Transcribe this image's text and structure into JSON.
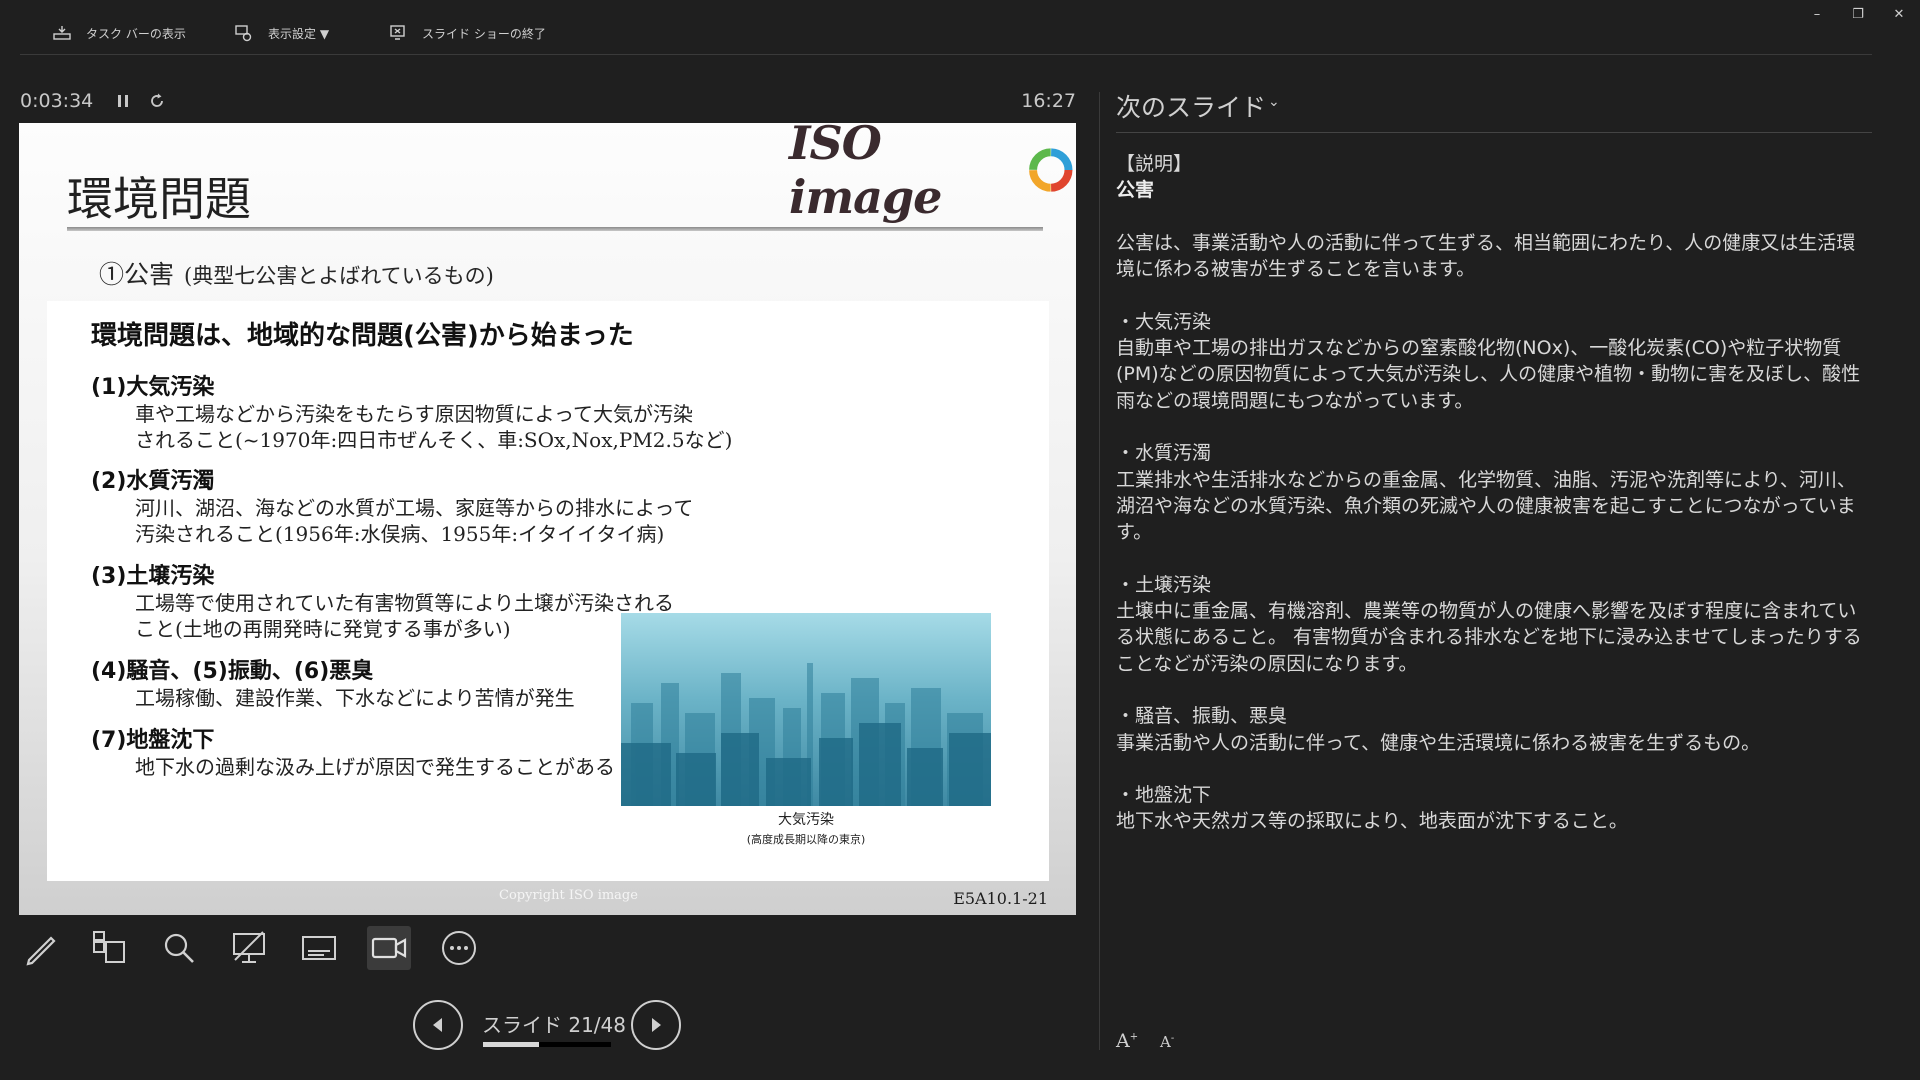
{
  "topbar": {
    "taskbar_label": "タスク バーの表示",
    "display_settings_label": "表示設定 ▼",
    "end_show_label": "スライド ショーの終了"
  },
  "window_controls": {
    "minimize": "–",
    "restore": "❐",
    "close": "✕"
  },
  "presenter": {
    "elapsed": "0:03:34",
    "clock": "16:27",
    "slide_counter": "スライド 21/48",
    "progress": 0.4375
  },
  "slide": {
    "title": "環境問題",
    "logo_text": "ISO image",
    "subheading": "①公害",
    "subheading_note": "(典型七公害とよばれているもの)",
    "content_heading": "環境問題は、地域的な問題(公害)から始まった",
    "items": [
      {
        "head": "(1)大気汚染",
        "body": "車や工場などから汚染をもたらす原因物質によって大気が汚染\nされること(~1970年:四日市ぜんそく、車:SOx,Nox,PM2.5など)"
      },
      {
        "head": "(2)水質汚濁",
        "body": "河川、湖沼、海などの水質が工場、家庭等からの排水によって\n汚染されること(1956年:水俣病、1955年:イタイイタイ病)"
      },
      {
        "head": "(3)土壌汚染",
        "body": "工場等で使用されていた有害物質等により土壌が汚染される\nこと(土地の再開発時に発覚する事が多い)"
      },
      {
        "head": "(4)騒音、(5)振動、(6)悪臭",
        "body": "工場稼働、建設作業、下水などにより苦情が発生"
      },
      {
        "head": "(7)地盤沈下",
        "body": "地下水の過剰な汲み上げが原因で発生することがある"
      }
    ],
    "photo_caption": "大気汚染",
    "photo_caption_sub": "(高度成長期以降の東京)",
    "copyright": "Copyright ISO image",
    "slide_code": "E5A10.1-21"
  },
  "notes": {
    "panel_title": "次のスライド",
    "lines": [
      "【説明】",
      "公害",
      "",
      "公害は、事業活動や人の活動に伴って生ずる、相当範囲にわたり、人の健康又は生活環境に係わる被害が生ずることを言います。",
      "",
      "・大気汚染",
      "自動車や工場の排出ガスなどからの窒素酸化物(NOx)、一酸化炭素(CO)や粒子状物質(PM)などの原因物質によって大気が汚染し、人の健康や植物・動物に害を及ぼし、酸性雨などの環境問題にもつながっています。",
      "",
      "・水質汚濁",
      "工業排水や生活排水などからの重金属、化学物質、油脂、汚泥や洗剤等により、河川、湖沼や海などの水質汚染、魚介類の死滅や人の健康被害を起こすことにつながっています。",
      "",
      "・土壌汚染",
      "土壌中に重金属、有機溶剤、農業等の物質が人の健康へ影響を及ぼす程度に含まれている状態にあること。 有害物質が含まれる排水などを地下に浸み込ませてしまったりすることなどが汚染の原因になります。",
      "",
      "・騒音、振動、悪臭",
      "事業活動や人の活動に伴って、健康や生活環境に係わる被害を生ずるもの。",
      "",
      "・地盤沈下",
      "地下水や天然ガス等の採取により、地表面が沈下すること。"
    ],
    "increase_font": "A",
    "decrease_font": "A"
  },
  "icons": {
    "taskbar": "taskbar-icon",
    "settings": "display-settings-icon",
    "end_show": "end-slideshow-icon",
    "pause": "pause-icon",
    "restart": "restart-icon",
    "pen": "pen-icon",
    "all_slides": "all-slides-icon",
    "zoom": "zoom-icon",
    "black_screen": "black-screen-icon",
    "subtitles": "subtitles-icon",
    "camera": "camera-icon",
    "more": "more-options-icon",
    "prev": "previous-slide-icon",
    "next": "next-slide-icon"
  }
}
